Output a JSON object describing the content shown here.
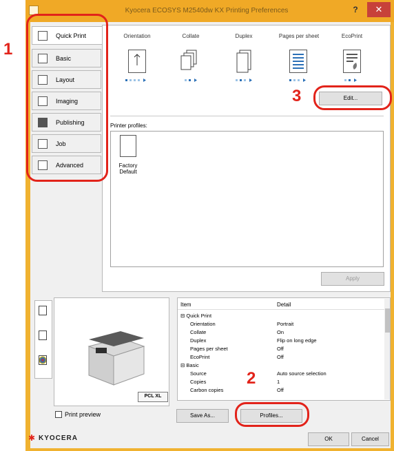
{
  "window": {
    "title": "Kyocera ECOSYS M2540dw KX Printing Preferences",
    "help_glyph": "?",
    "close_glyph": "✕"
  },
  "tabs": [
    {
      "label": "Quick Print",
      "icon": "quick-print-icon"
    },
    {
      "label": "Basic",
      "icon": "basic-icon"
    },
    {
      "label": "Layout",
      "icon": "layout-icon"
    },
    {
      "label": "Imaging",
      "icon": "imaging-icon"
    },
    {
      "label": "Publishing",
      "icon": "publishing-icon"
    },
    {
      "label": "Job",
      "icon": "job-icon"
    },
    {
      "label": "Advanced",
      "icon": "advanced-icon"
    }
  ],
  "quick_print": {
    "categories": [
      "Orientation",
      "Collate",
      "Duplex",
      "Pages per sheet",
      "EcoPrint"
    ],
    "edit_label": "Edit...",
    "profiles_label": "Printer profiles:",
    "profile_item": "Factory Default",
    "apply_label": "Apply"
  },
  "preview": {
    "pcl_badge": "PCL XL",
    "checkbox_label": "Print preview"
  },
  "detail_grid": {
    "headers": {
      "item": "Item",
      "detail": "Detail"
    },
    "rows": [
      {
        "item": "⊟ Quick Print",
        "detail": ""
      },
      {
        "item": "Orientation",
        "detail": "Portrait"
      },
      {
        "item": "Collate",
        "detail": "On"
      },
      {
        "item": "Duplex",
        "detail": "Flip on long edge"
      },
      {
        "item": "Pages per sheet",
        "detail": "Off"
      },
      {
        "item": "EcoPrint",
        "detail": "Off"
      },
      {
        "item": "⊟ Basic",
        "detail": ""
      },
      {
        "item": "Source",
        "detail": "Auto source selection"
      },
      {
        "item": "Copies",
        "detail": "1"
      },
      {
        "item": "Carbon copies",
        "detail": "Off"
      }
    ]
  },
  "buttons": {
    "save_as": "Save As...",
    "profiles": "Profiles...",
    "ok": "OK",
    "cancel": "Cancel"
  },
  "brand": {
    "logo": "KYOCERA"
  },
  "callouts": {
    "one": "1",
    "two": "2",
    "three": "3"
  },
  "colors": {
    "accent_red": "#e2231a",
    "titlebar": "#f0a926"
  }
}
